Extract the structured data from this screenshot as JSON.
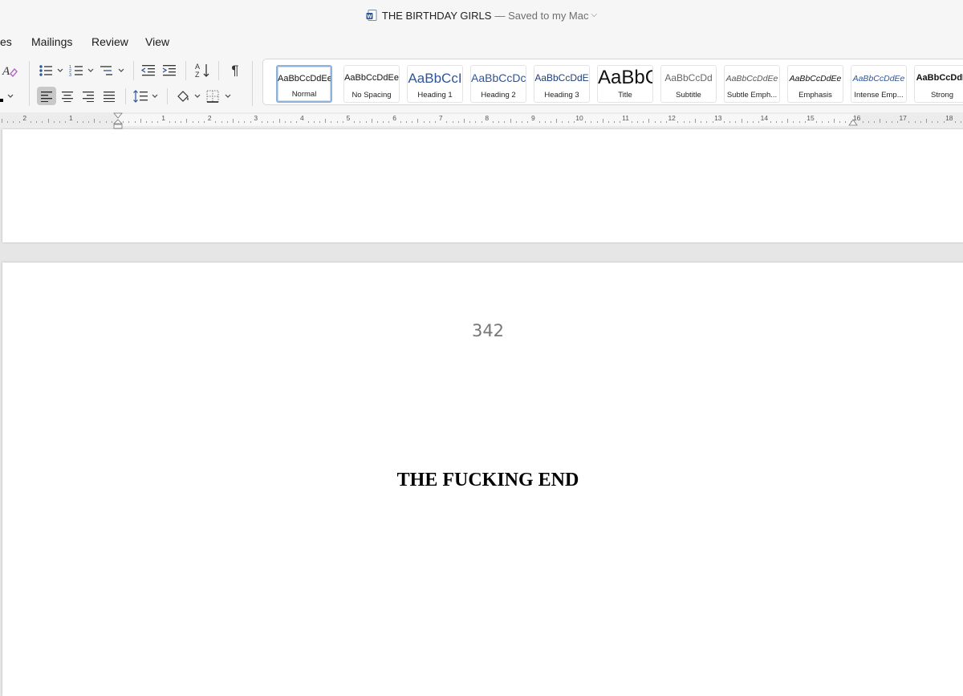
{
  "window": {
    "title": "THE BIRTHDAY GIRLS",
    "saved_status": "— Saved to my Mac",
    "title_chevron": "⌵"
  },
  "tabs": [
    {
      "label": "es"
    },
    {
      "label": "Mailings"
    },
    {
      "label": "Review"
    },
    {
      "label": "View"
    }
  ],
  "ribbon": {
    "pilcrow": "¶",
    "styles": [
      {
        "sample": "AaBbCcDdEe",
        "name": "Normal"
      },
      {
        "sample": "AaBbCcDdEe",
        "name": "No Spacing"
      },
      {
        "sample": "AaBbCcI",
        "name": "Heading 1"
      },
      {
        "sample": "AaBbCcDc",
        "name": "Heading 2"
      },
      {
        "sample": "AaBbCcDdE",
        "name": "Heading 3"
      },
      {
        "sample": "AaBbC",
        "name": "Title"
      },
      {
        "sample": "AaBbCcDd",
        "name": "Subtitle"
      },
      {
        "sample": "AaBbCcDdEe",
        "name": "Subtle Emph..."
      },
      {
        "sample": "AaBbCcDdEe",
        "name": "Emphasis"
      },
      {
        "sample": "AaBbCcDdEe",
        "name": "Intense Emp..."
      },
      {
        "sample": "AaBbCcDdE",
        "name": "Strong"
      }
    ]
  },
  "ruler": {
    "left_labels": [
      "2",
      "1"
    ],
    "right_labels": [
      "1",
      "2",
      "3",
      "4",
      "5",
      "6",
      "7",
      "8",
      "9",
      "10",
      "11",
      "12",
      "13",
      "14",
      "15",
      "16",
      "17",
      "18"
    ]
  },
  "document": {
    "page_number": "342",
    "heading": "THE FUCKING END"
  },
  "colors": {
    "accent_blue": "#2b5797",
    "selected_card_border": "#8fb2d9"
  }
}
